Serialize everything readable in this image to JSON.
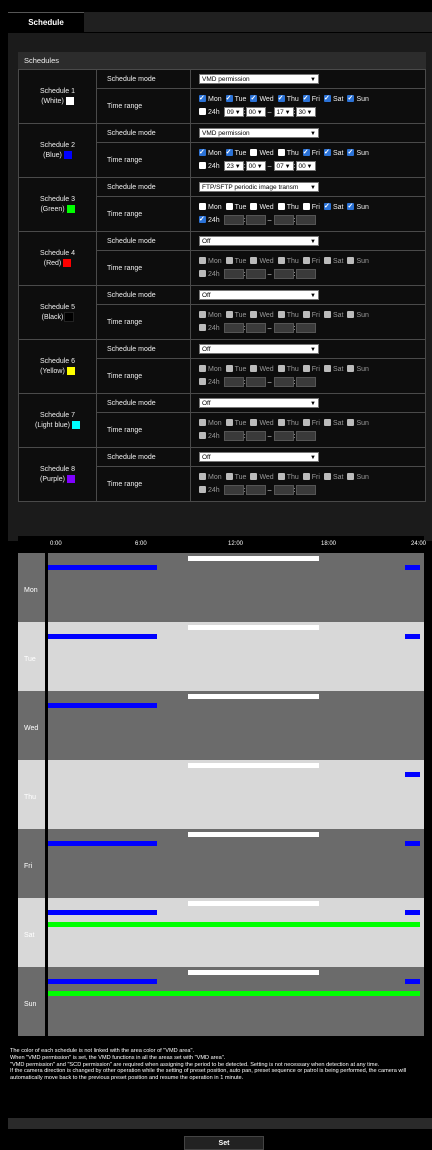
{
  "tab": {
    "label": "Schedule"
  },
  "section_title": "Schedules",
  "labels": {
    "mode": "Schedule mode",
    "range": "Time range",
    "h24": "24h",
    "dash": "–"
  },
  "days": [
    "Mon",
    "Tue",
    "Wed",
    "Thu",
    "Fri",
    "Sat",
    "Sun"
  ],
  "schedules": [
    {
      "name": "Schedule 1",
      "color_name": "(White)",
      "color": "#ffffff",
      "mode": "VMD permission",
      "days_on": [
        true,
        true,
        true,
        true,
        true,
        true,
        true
      ],
      "h24": false,
      "start_h": "09",
      "start_m": "00",
      "end_h": "17",
      "end_m": "30",
      "enabled": true
    },
    {
      "name": "Schedule 2",
      "color_name": "(Blue)",
      "color": "#0000ff",
      "mode": "VMD permission",
      "days_on": [
        true,
        true,
        false,
        false,
        true,
        true,
        true
      ],
      "h24": false,
      "start_h": "23",
      "start_m": "00",
      "end_h": "07",
      "end_m": "00",
      "enabled": true
    },
    {
      "name": "Schedule 3",
      "color_name": "(Green)",
      "color": "#00ff00",
      "mode": "FTP/SFTP periodic image transm",
      "days_on": [
        false,
        false,
        false,
        false,
        false,
        true,
        true
      ],
      "h24": true,
      "start_h": "",
      "start_m": "",
      "end_h": "",
      "end_m": "",
      "enabled": true
    },
    {
      "name": "Schedule 4",
      "color_name": "(Red)",
      "color": "#ff0000",
      "mode": "Off",
      "days_on": [
        false,
        false,
        false,
        false,
        false,
        false,
        false
      ],
      "h24": false,
      "start_h": "",
      "start_m": "",
      "end_h": "",
      "end_m": "",
      "enabled": false
    },
    {
      "name": "Schedule 5",
      "color_name": "(Black)",
      "color": "#000000",
      "mode": "Off",
      "days_on": [
        false,
        false,
        false,
        false,
        false,
        false,
        false
      ],
      "h24": false,
      "start_h": "",
      "start_m": "",
      "end_h": "",
      "end_m": "",
      "enabled": false
    },
    {
      "name": "Schedule 6",
      "color_name": "(Yellow)",
      "color": "#ffff00",
      "mode": "Off",
      "days_on": [
        false,
        false,
        false,
        false,
        false,
        false,
        false
      ],
      "h24": false,
      "start_h": "",
      "start_m": "",
      "end_h": "",
      "end_m": "",
      "enabled": false
    },
    {
      "name": "Schedule 7",
      "color_name": "(Light blue)",
      "color": "#00ffff",
      "mode": "Off",
      "days_on": [
        false,
        false,
        false,
        false,
        false,
        false,
        false
      ],
      "h24": false,
      "start_h": "",
      "start_m": "",
      "end_h": "",
      "end_m": "",
      "enabled": false
    },
    {
      "name": "Schedule 8",
      "color_name": "(Purple)",
      "color": "#8000ff",
      "mode": "Off",
      "days_on": [
        false,
        false,
        false,
        false,
        false,
        false,
        false
      ],
      "h24": false,
      "start_h": "",
      "start_m": "",
      "end_h": "",
      "end_m": "",
      "enabled": false
    }
  ],
  "timeline": {
    "hours": [
      "0:00",
      "6:00",
      "12:00",
      "18:00",
      "24:00"
    ],
    "row_colors": [
      "#6b6b6b",
      "#d8d8d8"
    ],
    "rows": [
      {
        "day": "Mon",
        "bars": [
          {
            "color": "#ffffff",
            "start": 9.0,
            "end": 17.5
          },
          {
            "color": "#0000ff",
            "start": 0.0,
            "end": 7.0
          },
          {
            "color": "#0000ff",
            "start": 23.0,
            "end": 24.0
          }
        ]
      },
      {
        "day": "Tue",
        "bars": [
          {
            "color": "#ffffff",
            "start": 9.0,
            "end": 17.5
          },
          {
            "color": "#0000ff",
            "start": 0.0,
            "end": 7.0
          },
          {
            "color": "#0000ff",
            "start": 23.0,
            "end": 24.0
          }
        ]
      },
      {
        "day": "Wed",
        "bars": [
          {
            "color": "#ffffff",
            "start": 9.0,
            "end": 17.5
          },
          {
            "color": "#0000ff",
            "start": 0.0,
            "end": 7.0
          }
        ]
      },
      {
        "day": "Thu",
        "bars": [
          {
            "color": "#ffffff",
            "start": 9.0,
            "end": 17.5
          },
          {
            "color": "#0000ff",
            "start": 23.0,
            "end": 24.0
          }
        ]
      },
      {
        "day": "Fri",
        "bars": [
          {
            "color": "#ffffff",
            "start": 9.0,
            "end": 17.5
          },
          {
            "color": "#0000ff",
            "start": 0.0,
            "end": 7.0
          },
          {
            "color": "#0000ff",
            "start": 23.0,
            "end": 24.0
          }
        ]
      },
      {
        "day": "Sat",
        "bars": [
          {
            "color": "#ffffff",
            "start": 9.0,
            "end": 17.5
          },
          {
            "color": "#0000ff",
            "start": 0.0,
            "end": 7.0
          },
          {
            "color": "#0000ff",
            "start": 23.0,
            "end": 24.0
          },
          {
            "color": "#00ff00",
            "start": 0.0,
            "end": 24.0
          }
        ]
      },
      {
        "day": "Sun",
        "bars": [
          {
            "color": "#ffffff",
            "start": 9.0,
            "end": 17.5
          },
          {
            "color": "#0000ff",
            "start": 0.0,
            "end": 7.0
          },
          {
            "color": "#0000ff",
            "start": 23.0,
            "end": 24.0
          },
          {
            "color": "#00ff00",
            "start": 0.0,
            "end": 24.0
          }
        ]
      }
    ]
  },
  "notes": [
    "The color of each schedule is not linked with the area color of \"VMD area\".",
    "When \"VMD permission\" is set, the VMD functions in all the areas set with \"VMD area\".",
    "\"VMD permission\" and \"SCD permission\" are required when assigning the period to be detected. Setting is not necessary when detection at any time.",
    "If the camera direction is changed by other operation while the setting of preset position, auto pan, preset sequence or patrol is being performed, the camera will automatically move back to the previous preset position and resume the operation in 1 minute."
  ],
  "set_button": "Set"
}
